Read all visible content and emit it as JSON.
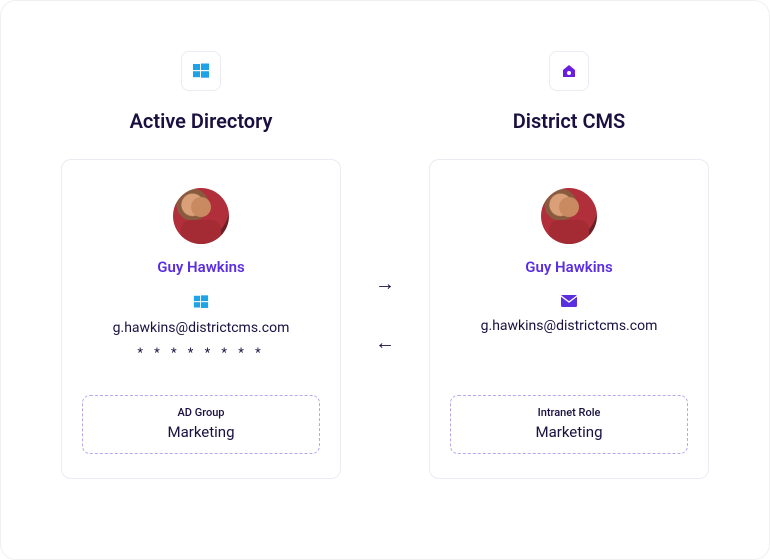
{
  "left": {
    "title": "Active Directory",
    "name": "Guy Hawkins",
    "email": "g.hawkins@districtcms.com",
    "password_mask": "* * * * * * * *",
    "role_label": "AD Group",
    "role_value": "Marketing"
  },
  "right": {
    "title": "District CMS",
    "name": "Guy Hawkins",
    "email": "g.hawkins@districtcms.com",
    "role_label": "Intranet Role",
    "role_value": "Marketing"
  },
  "arrows": {
    "right": "→",
    "left": "←"
  }
}
